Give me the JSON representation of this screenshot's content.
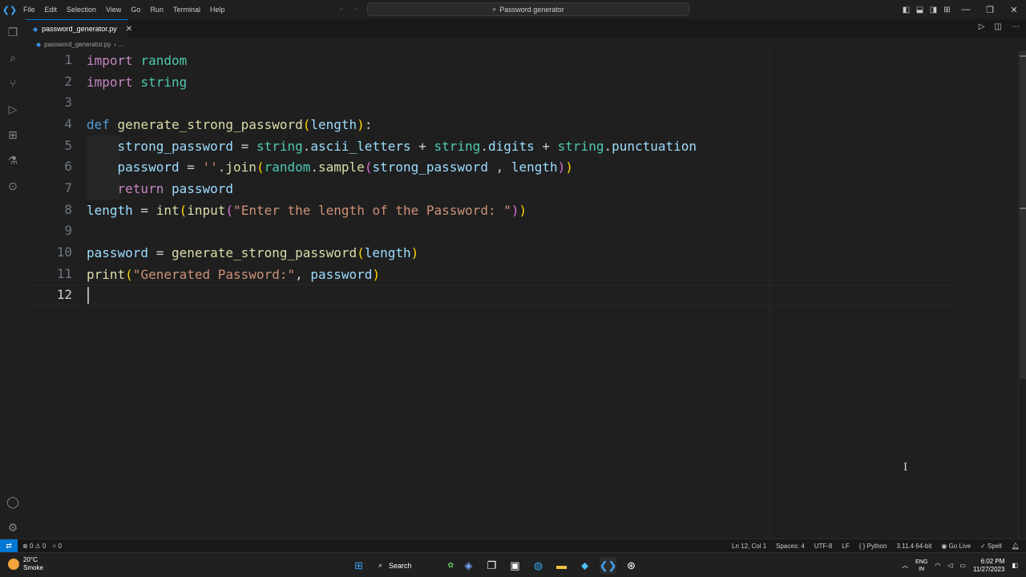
{
  "window": {
    "search_title": "Password generator"
  },
  "menu": [
    "File",
    "Edit",
    "Selection",
    "View",
    "Go",
    "Run",
    "Terminal",
    "Help"
  ],
  "activity_bar": [
    "explorer-icon",
    "search-icon",
    "source-control-icon",
    "run-debug-icon",
    "extensions-icon",
    "testing-icon",
    "remote-icon"
  ],
  "tab": {
    "filename": "password_generator.py",
    "close": "✕"
  },
  "breadcrumb": {
    "file": "password_generator.py",
    "trail": "› ..."
  },
  "editor": {
    "line_numbers": [
      "1",
      "2",
      "3",
      "4",
      "5",
      "6",
      "7",
      "8",
      "9",
      "10",
      "11",
      "12"
    ],
    "lines": [
      "import random",
      "import string",
      "",
      "def generate_strong_password(length):",
      "    strong_password = string.ascii_letters + string.digits + string.punctuation",
      "    password = ''.join(random.sample(strong_password , length))",
      "    return password",
      "length = int(input(\"Enter the length of the Password: \"))",
      "",
      "password = generate_strong_password(length)",
      "print(\"Generated Password:\", password)",
      ""
    ],
    "active_line": 12
  },
  "statusbar": {
    "errors": "0",
    "warnings": "0",
    "ports": "0",
    "position": "Ln 12, Col 1",
    "spaces": "Spaces: 4",
    "encoding": "UTF-8",
    "eol": "LF",
    "language": "Python",
    "interpreter": "3.11.4 64-bit",
    "golive": "Go Live",
    "spell": "Spell"
  },
  "taskbar": {
    "weather_temp": "20°C",
    "weather_desc": "Smoke",
    "search_label": "Search",
    "lang_top": "ENG",
    "lang_bottom": "IN",
    "time": "6:02 PM",
    "date": "11/27/2023"
  },
  "colors": {
    "accent": "#0078d4",
    "keyword": "#c586c0",
    "function": "#dcdcaa",
    "string": "#ce9178",
    "module": "#4ec9b0",
    "variable": "#9cdcfe"
  }
}
